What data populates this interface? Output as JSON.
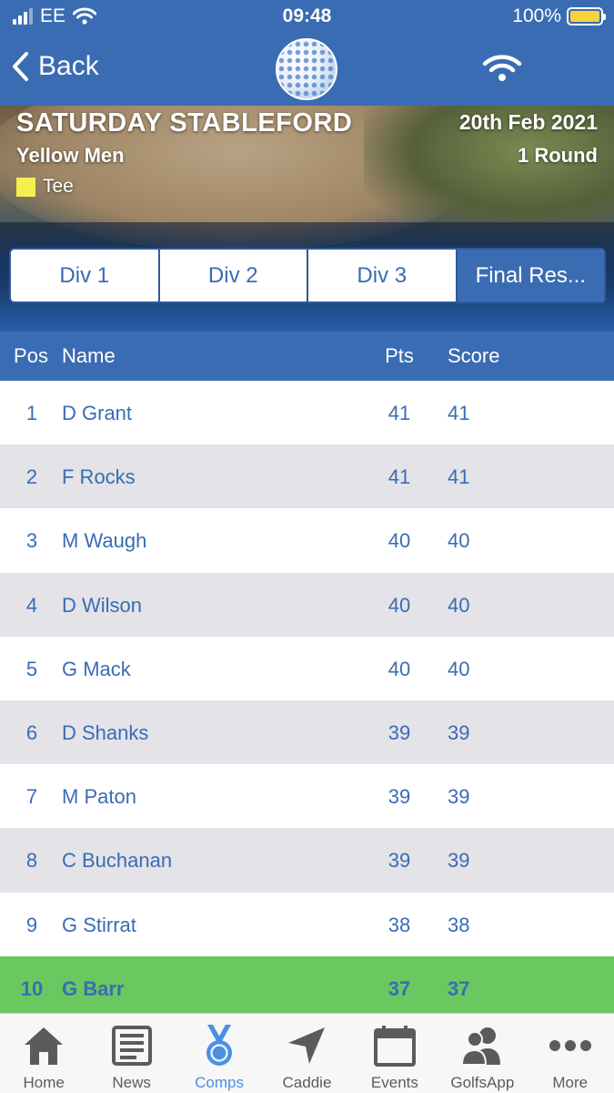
{
  "status_bar": {
    "carrier": "EE",
    "time": "09:48",
    "battery": "100%"
  },
  "nav": {
    "back_label": "Back"
  },
  "competition": {
    "title": "SATURDAY STABLEFORD",
    "date": "20th Feb 2021",
    "category": "Yellow Men",
    "rounds": "1 Round",
    "tee_label": "Tee",
    "tee_color": "#f5f050"
  },
  "segments": {
    "div1": "Div 1",
    "div2": "Div 2",
    "div3": "Div 3",
    "final": "Final Res..."
  },
  "table": {
    "headers": {
      "pos": "Pos",
      "name": "Name",
      "pts": "Pts",
      "score": "Score"
    },
    "rows": [
      {
        "pos": "1",
        "name": "D Grant",
        "pts": "41",
        "score": "41"
      },
      {
        "pos": "2",
        "name": "F Rocks",
        "pts": "41",
        "score": "41"
      },
      {
        "pos": "3",
        "name": "M Waugh",
        "pts": "40",
        "score": "40"
      },
      {
        "pos": "4",
        "name": "D Wilson",
        "pts": "40",
        "score": "40"
      },
      {
        "pos": "5",
        "name": "G Mack",
        "pts": "40",
        "score": "40"
      },
      {
        "pos": "6",
        "name": "D Shanks",
        "pts": "39",
        "score": "39"
      },
      {
        "pos": "7",
        "name": "M Paton",
        "pts": "39",
        "score": "39"
      },
      {
        "pos": "8",
        "name": "C Buchanan",
        "pts": "39",
        "score": "39"
      },
      {
        "pos": "9",
        "name": "G Stirrat",
        "pts": "38",
        "score": "38"
      },
      {
        "pos": "10",
        "name": "G Barr",
        "pts": "37",
        "score": "37"
      }
    ]
  },
  "tabs": {
    "home": "Home",
    "news": "News",
    "comps": "Comps",
    "caddie": "Caddie",
    "events": "Events",
    "golfsapp": "GolfsApp",
    "more": "More"
  },
  "colors": {
    "brand_blue": "#3a6cb3",
    "row_alt": "#e3e3e8",
    "highlight_green": "#69c860",
    "active_tab": "#4a90e2"
  }
}
